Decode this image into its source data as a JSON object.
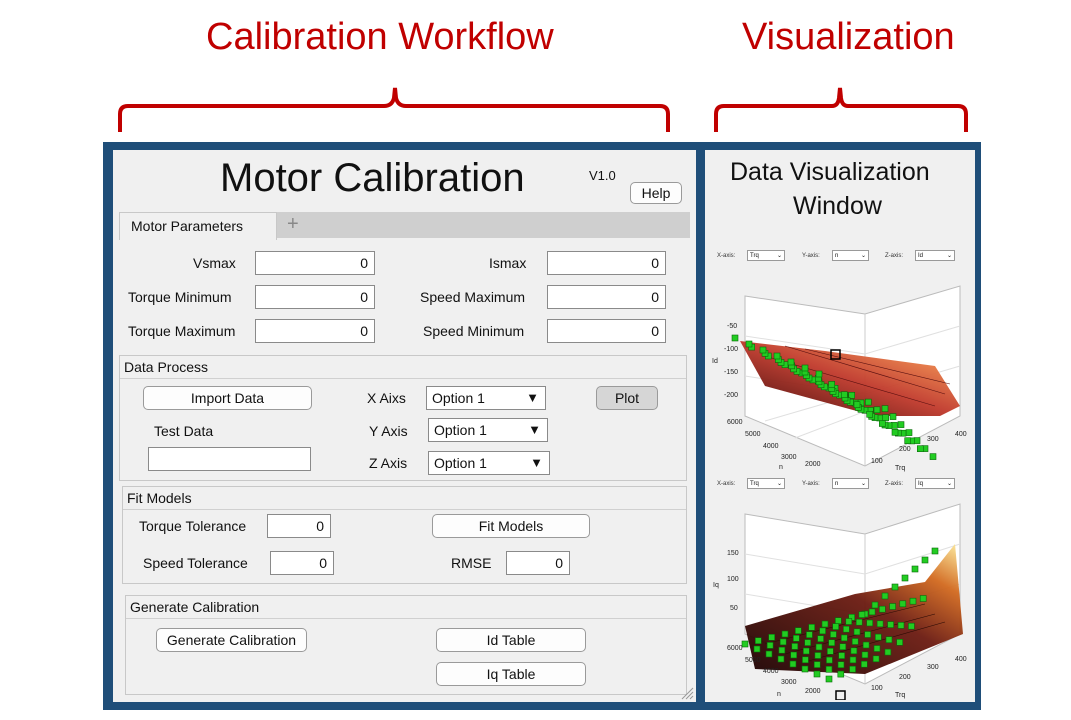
{
  "headings": {
    "left": "Calibration Workflow",
    "right": "Visualization"
  },
  "app": {
    "title": "Motor Calibration",
    "version": "V1.0",
    "help_label": "Help",
    "tabs": [
      {
        "label": "Motor Parameters"
      },
      {
        "label": "+"
      }
    ],
    "params": {
      "vsmax": {
        "label": "Vsmax",
        "value": "0"
      },
      "ismax": {
        "label": "Ismax",
        "value": "0"
      },
      "torque_min": {
        "label": "Torque Minimum",
        "value": "0"
      },
      "speed_max": {
        "label": "Speed Maximum",
        "value": "0"
      },
      "torque_max": {
        "label": "Torque Maximum",
        "value": "0"
      },
      "speed_min": {
        "label": "Speed Minimum",
        "value": "0"
      }
    },
    "data_process": {
      "title": "Data Process",
      "import_label": "Import Data",
      "test_data_label": "Test Data",
      "test_data_value": "",
      "x_axis_label": "X Aixs",
      "y_axis_label": "Y Axis",
      "z_axis_label": "Z Axis",
      "x_axis_value": "Option 1",
      "y_axis_value": "Option 1",
      "z_axis_value": "Option 1",
      "plot_label": "Plot"
    },
    "fit_models": {
      "title": "Fit Models",
      "torque_tol_label": "Torque Tolerance",
      "torque_tol_value": "0",
      "speed_tol_label": "Speed Tolerance",
      "speed_tol_value": "0",
      "fit_label": "Fit Models",
      "rmse_label": "RMSE",
      "rmse_value": "0"
    },
    "generate": {
      "title": "Generate Calibration",
      "generate_label": "Generate Calibration",
      "id_table_label": "Id Table",
      "iq_table_label": "Iq Table"
    }
  },
  "viz": {
    "title_line1": "Data Visualization",
    "title_line2": "Window",
    "plot1": {
      "x_label": "X-axis:",
      "x_value": "Trq",
      "y_label": "Y-axis:",
      "y_value": "n",
      "z_label": "Z-axis:",
      "z_value": "Id",
      "z_ticks": [
        "-50",
        "-100",
        "-150",
        "-200"
      ],
      "n_ticks": [
        "6000",
        "5000",
        "4000",
        "3000",
        "2000"
      ],
      "trq_ticks": [
        "100",
        "200",
        "300",
        "400"
      ],
      "n_axis": "n",
      "trq_axis": "Trq",
      "z_axis": "Id"
    },
    "plot2": {
      "x_label": "X-axis:",
      "x_value": "Trq",
      "y_label": "Y-axis:",
      "y_value": "n",
      "z_label": "Z-axis:",
      "z_value": "Iq",
      "z_ticks": [
        "150",
        "100",
        "50"
      ],
      "n_ticks": [
        "6000",
        "5000",
        "4000",
        "3000",
        "2000"
      ],
      "trq_ticks": [
        "100",
        "200",
        "300",
        "400"
      ],
      "n_axis": "n",
      "trq_axis": "Trq",
      "z_axis": "Iq"
    }
  },
  "colors": {
    "heading": "#c00000",
    "frame": "#1f4e79",
    "marker": "#22cc22"
  }
}
